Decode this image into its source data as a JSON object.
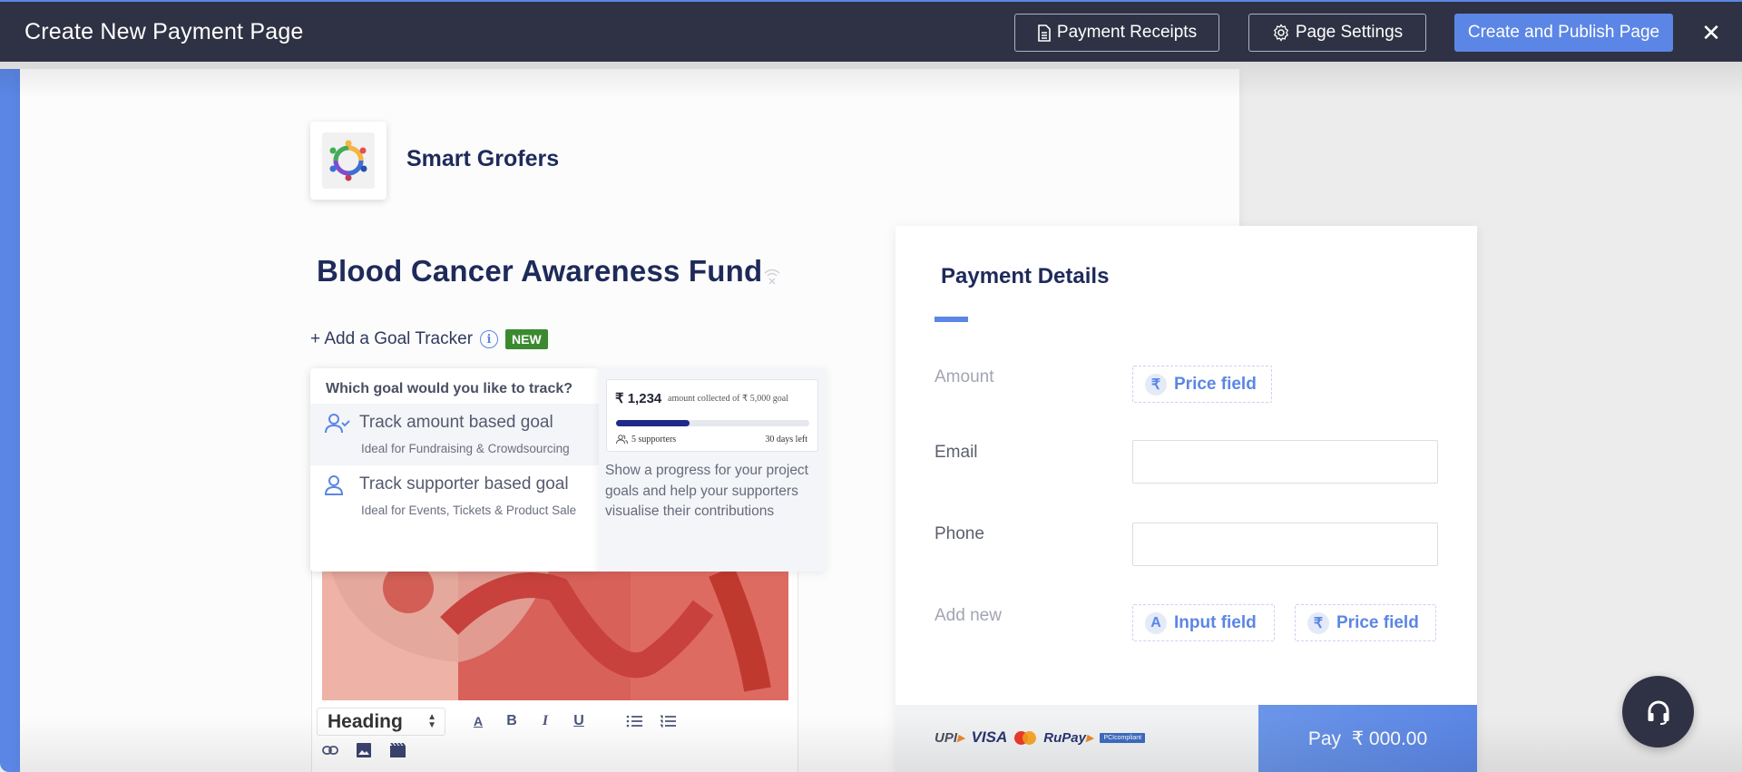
{
  "topbar": {
    "title": "Create New Payment Page",
    "payment_receipts_label": "Payment Receipts",
    "page_settings_label": "Page Settings",
    "publish_label": "Create and Publish Page",
    "close_label": "✕"
  },
  "brand": {
    "name": "Smart Grofers"
  },
  "page": {
    "title": "Blood Cancer Awareness Fund",
    "goal_tracker_label": "+ Add a Goal Tracker",
    "new_badge": "NEW"
  },
  "goal_popup": {
    "question": "Which goal would you like to track?",
    "options": [
      {
        "title": "Track amount based goal",
        "subtitle": "Ideal for Fundraising & Crowdsourcing",
        "icon": "user-check-icon"
      },
      {
        "title": "Track supporter based goal",
        "subtitle": "Ideal for Events, Tickets & Product Sale",
        "icon": "user-icon"
      }
    ],
    "preview": {
      "amount": "₹ 1,234",
      "amount_caption": "amount collected of ₹ 5,000 goal",
      "progress_fraction": 0.38,
      "supporters": "5 supporters",
      "days_left": "30 days left",
      "description": "Show a progress for your project goals and help your supporters visualise their contributions"
    }
  },
  "editor": {
    "block_type": "Heading",
    "tools": [
      "text-color",
      "bold",
      "italic",
      "underline",
      "bullet-list",
      "numbered-list",
      "link",
      "image",
      "video"
    ]
  },
  "payment": {
    "title": "Payment Details",
    "fields": [
      {
        "label": "Amount",
        "type": "price-field-button",
        "button_label": "Price field"
      },
      {
        "label": "Email",
        "type": "input",
        "value": ""
      },
      {
        "label": "Phone",
        "type": "input",
        "value": ""
      }
    ],
    "add_new_label": "Add new",
    "add_input_label": "Input field",
    "add_price_label": "Price field",
    "payment_methods": [
      "UPI",
      "VISA",
      "Mastercard",
      "RuPay",
      "PCI compliant"
    ],
    "pay_button": "Pay  ₹ 000.00"
  },
  "colors": {
    "accent": "#5b86e5",
    "topbar": "#2f3244",
    "heading": "#1e2a5a",
    "new_badge": "#3b8a2f"
  }
}
